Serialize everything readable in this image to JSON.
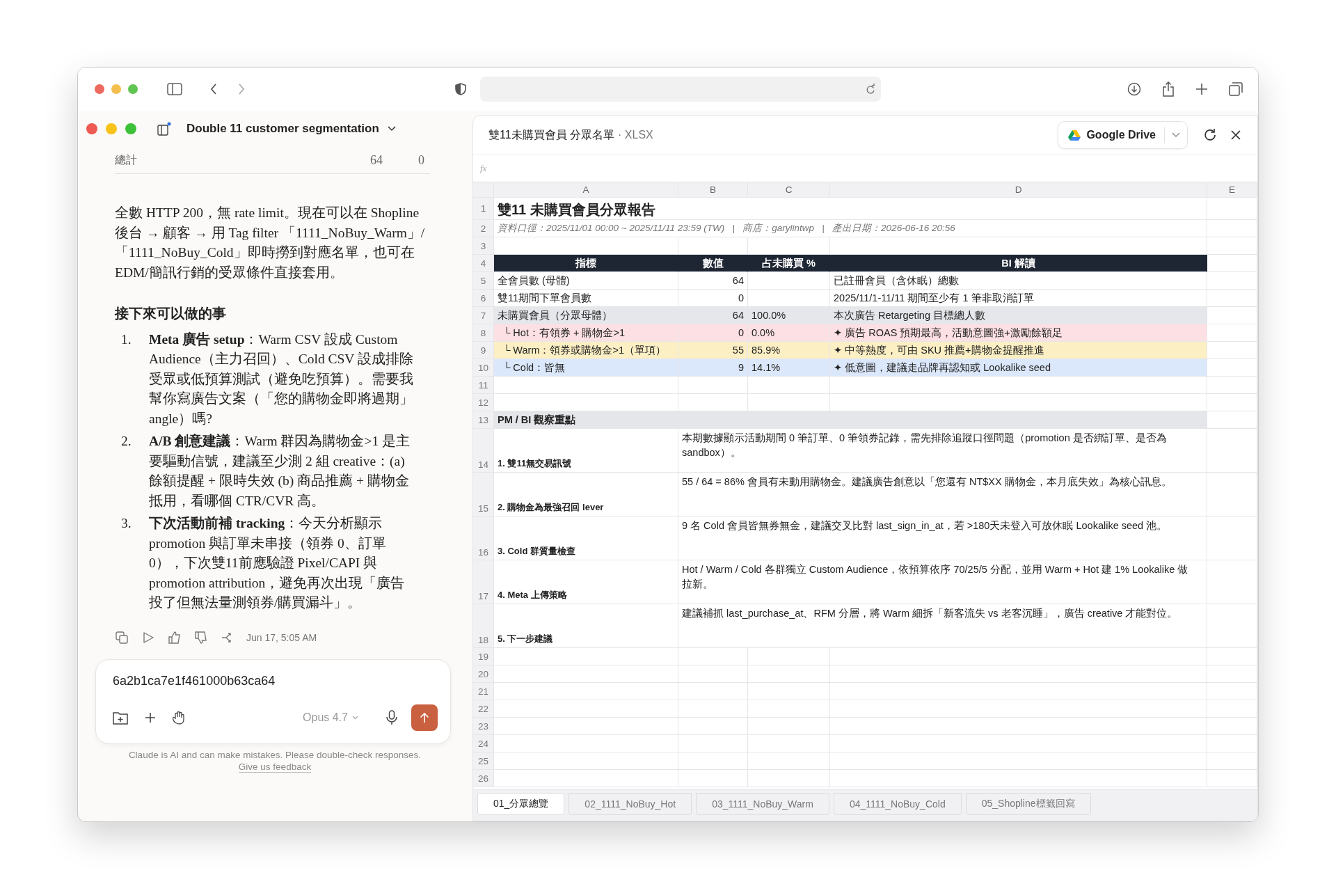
{
  "chat": {
    "title": "Double 11 customer segmentation",
    "total_row": {
      "label": "總計",
      "value_1": "64",
      "value_2": "0"
    },
    "paragraph": "全數 HTTP 200，無 rate limit。現在可以在 Shopline 後台 → 顧客 → 用 Tag filter 「1111_NoBuy_Warm」/「1111_NoBuy_Cold」即時撈到對應名單，也可在 EDM/簡訊行銷的受眾條件直接套用。",
    "heading": "接下來可以做的事",
    "list": [
      {
        "num": "1.",
        "text": "**Meta 廣告 setup**：Warm CSV 設成 Custom Audience（主力召回）、Cold CSV 設成排除受眾或低預算測試（避免吃預算）。需要我幫你寫廣告文案（「您的購物金即將過期」angle）嗎?"
      },
      {
        "num": "2.",
        "text": "**A/B 創意建議**：Warm 群因為購物金>1 是主要驅動信號，建議至少測 2 組 creative：(a) 餘額提醒 + 限時失效 (b) 商品推薦 + 購物金抵用，看哪個 CTR/CVR 高。"
      },
      {
        "num": "3.",
        "text": "**下次活動前補 tracking**：今天分析顯示 promotion 與訂單未串接（領券 0、訂單 0），下次雙11前應驗證 Pixel/CAPI 與 promotion attribution，避免再次出現「廣告投了但無法量測領券/購買漏斗」。"
      }
    ],
    "timestamp": "Jun 17, 5:05 AM",
    "input": {
      "value": "6a2b1ca7e1f461000b63ca64"
    },
    "model": "Opus 4.7",
    "disclaimer": "Claude is AI and can make mistakes. Please double-check responses.",
    "feedback_link": "Give us feedback"
  },
  "sheet": {
    "title": "雙11未購買會員 分眾名單",
    "file_type": "· XLSX",
    "drive_button": "Google Drive",
    "formula_label": "fx",
    "columns": [
      "A",
      "B",
      "C",
      "D",
      "E"
    ],
    "rows": [
      {
        "num": "1",
        "kind": "title",
        "a": "雙11 未購買會員分眾報告"
      },
      {
        "num": "2",
        "kind": "meta",
        "a": "資料口徑：2025/11/01 00:00 ~ 2025/11/11 23:59 (TW)   |   商店：garylintwp   |   產出日期：2026-06-16 20:56"
      },
      {
        "num": "3",
        "kind": "blank"
      },
      {
        "num": "4",
        "kind": "header",
        "labels": [
          "指標",
          "數值",
          "占未購買 %",
          "BI 解讀"
        ]
      },
      {
        "num": "5",
        "kind": "data",
        "a": "全會員數 (母體)",
        "b": "64",
        "d": "已註冊會員（含休眠）總數"
      },
      {
        "num": "6",
        "kind": "data",
        "a": "雙11期間下單會員數",
        "b": "0",
        "d": "2025/11/1-11/11 期間至少有 1 筆非取消訂單"
      },
      {
        "num": "7",
        "kind": "data",
        "a": "未購買會員（分眾母體）",
        "b": "64",
        "c": "100.0%",
        "d": "本次廣告 Retargeting 目標總人數",
        "color": "#e5e7eb"
      },
      {
        "num": "8",
        "kind": "data",
        "a": "  └ Hot：有領券 + 購物金>1",
        "b": "0",
        "c": "0.0%",
        "d": "✦ 廣告 ROAS 預期最高，活動意圖強+激勵餘額足",
        "color": "#fde0e3"
      },
      {
        "num": "9",
        "kind": "data",
        "a": "  └ Warm：領券或購物金>1（單項）",
        "b": "55",
        "c": "85.9%",
        "d": "✦ 中等熱度，可由 SKU 推薦+購物金提醒推進",
        "color": "#fcefc4"
      },
      {
        "num": "10",
        "kind": "data",
        "a": "  └ Cold：皆無",
        "b": "9",
        "c": "14.1%",
        "d": "✦ 低意圖，建議走品牌再認知或 Lookalike seed",
        "color": "#dbe7fa"
      },
      {
        "num": "11",
        "kind": "blank"
      },
      {
        "num": "12",
        "kind": "blank"
      },
      {
        "num": "13",
        "kind": "section",
        "a": "PM / BI 觀察重點"
      },
      {
        "num": "14",
        "kind": "note",
        "a": "1. 雙11無交易訊號",
        "d": "本期數據顯示活動期間 0 筆訂單、0 筆領券記錄，需先排除追蹤口徑問題（promotion 是否綁訂單、是否為 sandbox）。"
      },
      {
        "num": "15",
        "kind": "note",
        "a": "2. 購物金為最強召回 lever",
        "d": "55 / 64 = 86% 會員有未動用購物金。建議廣告創意以「您還有 NT$XX 購物金，本月底失效」為核心訊息。"
      },
      {
        "num": "16",
        "kind": "note",
        "a": "3. Cold 群質量檢查",
        "d": "9 名 Cold 會員皆無券無金，建議交叉比對 last_sign_in_at，若 >180天未登入可放休眠 Lookalike seed 池。"
      },
      {
        "num": "17",
        "kind": "note",
        "a": "4. Meta 上傳策略",
        "d": "Hot / Warm / Cold 各群獨立 Custom Audience，依預算依序 70/25/5 分配，並用 Warm + Hot 建 1% Lookalike 做拉新。"
      },
      {
        "num": "18",
        "kind": "note",
        "a": "5. 下一步建議",
        "d": "建議補抓 last_purchase_at、RFM 分層，將 Warm 細拆「新客流失 vs 老客沉睡」，廣告 creative 才能對位。"
      },
      {
        "num": "19",
        "kind": "blank"
      },
      {
        "num": "20",
        "kind": "blank"
      },
      {
        "num": "21",
        "kind": "blank"
      },
      {
        "num": "22",
        "kind": "blank"
      },
      {
        "num": "23",
        "kind": "blank"
      },
      {
        "num": "24",
        "kind": "blank"
      },
      {
        "num": "25",
        "kind": "blank"
      },
      {
        "num": "26",
        "kind": "blank"
      }
    ],
    "tabs": [
      {
        "label": "01_分眾總覽",
        "selected": true
      },
      {
        "label": "02_1111_NoBuy_Hot",
        "selected": false
      },
      {
        "label": "03_1111_NoBuy_Warm",
        "selected": false
      },
      {
        "label": "04_1111_NoBuy_Cold",
        "selected": false
      },
      {
        "label": "05_Shopline標籤回寫",
        "selected": false
      }
    ]
  }
}
